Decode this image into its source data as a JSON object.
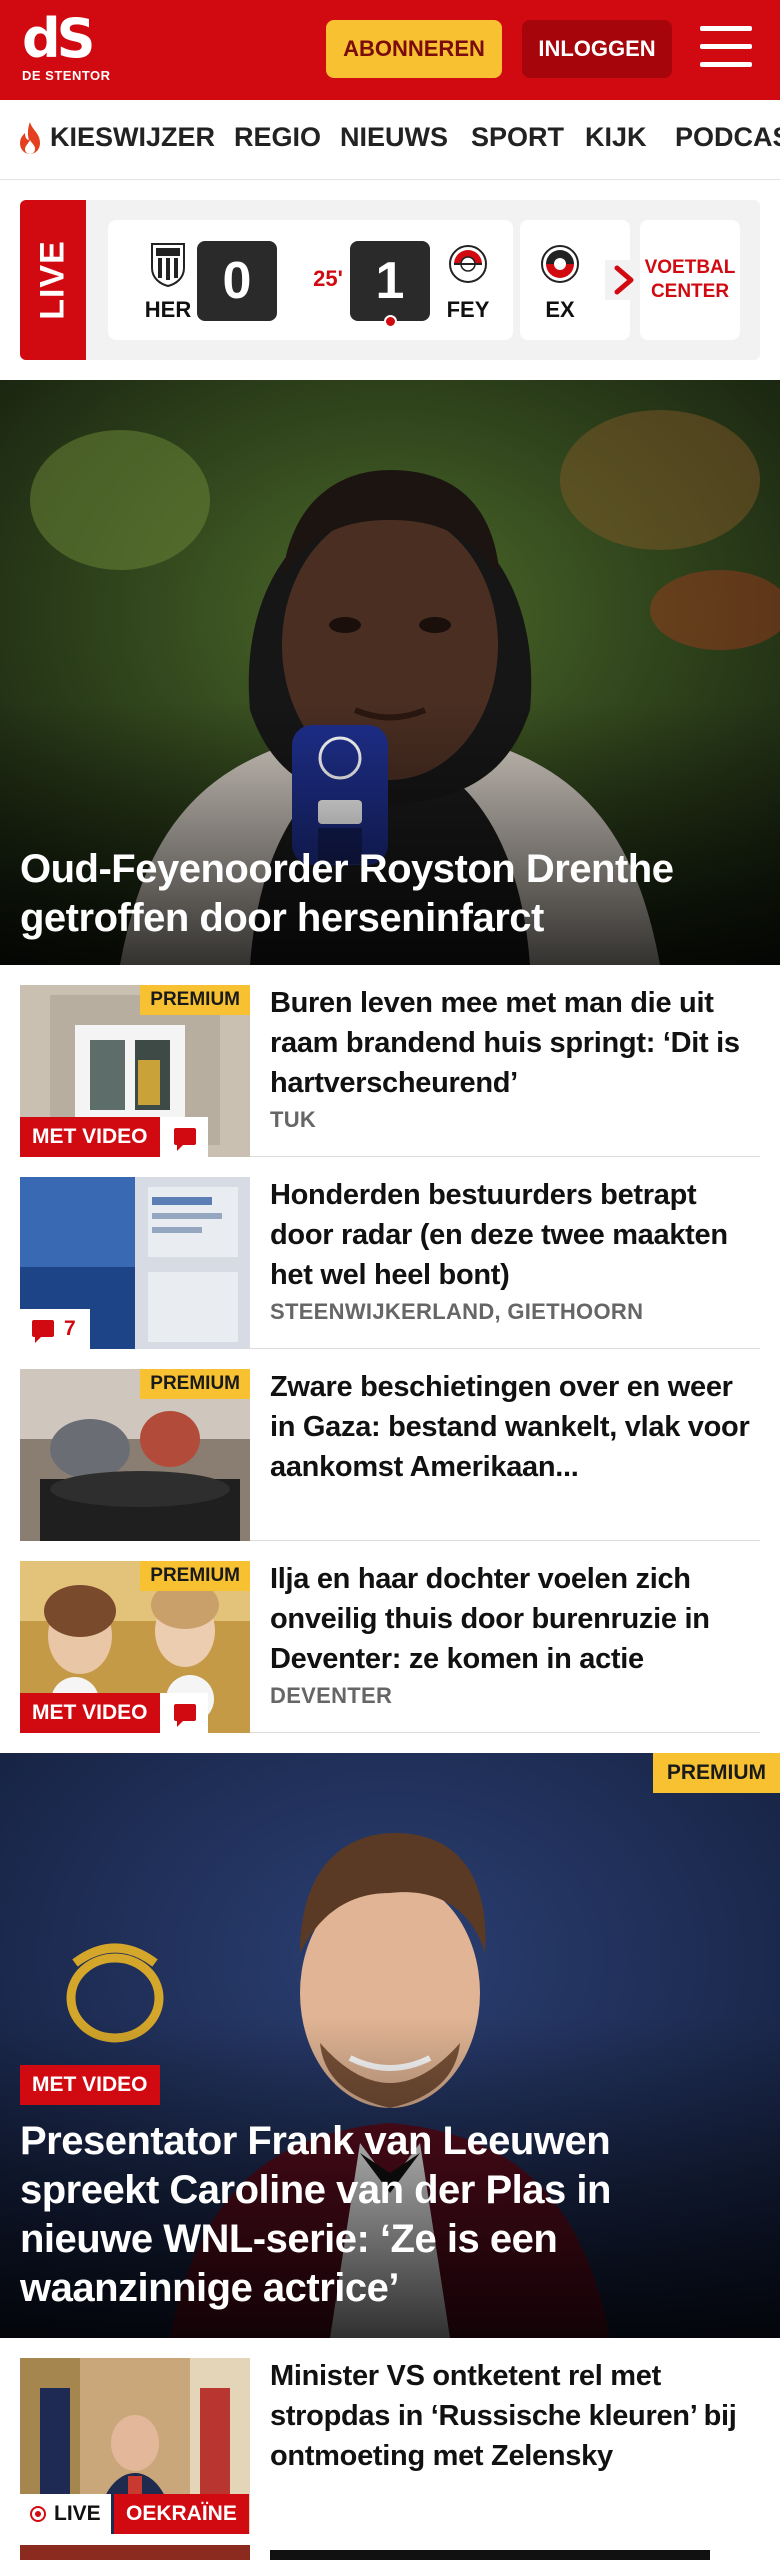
{
  "header": {
    "logo_mark": "dS",
    "logo_sub": "DE STENTOR",
    "subscribe_label": "ABONNEREN",
    "login_label": "INLOGGEN",
    "brand_color": "#d10a11",
    "accent_color": "#f7c132"
  },
  "nav": {
    "items": [
      "KIESWIJZER",
      "REGIO",
      "NIEUWS",
      "SPORT",
      "KIJK",
      "PODCAS"
    ]
  },
  "live": {
    "label": "LIVE",
    "match": {
      "home_code": "HER",
      "away_code": "FEY",
      "home_score": "0",
      "away_score": "1",
      "minute": "25'"
    },
    "next_match_code": "EX",
    "voetbal_center_label": "VOETBAL CENTER"
  },
  "hero": {
    "title": "Oud-Feyenoorder Royston Drenthe getroffen door herseninfarct"
  },
  "articles": [
    {
      "title": "Buren leven mee met man die uit raam brandend huis springt: ‘Dit is hartverscheurend’",
      "meta": "TUK",
      "premium": "PREMIUM",
      "video": "MET VIDEO"
    },
    {
      "title": "Honderden bestuurders betrapt door radar (en deze twee maakten het wel heel bont)",
      "meta": "STEENWIJKERLAND, GIETHOORN",
      "comments": "7"
    },
    {
      "title": "Zware beschietingen over en weer in Gaza: bestand wankelt, vlak voor aankomst Amerikaan...",
      "premium": "PREMIUM"
    },
    {
      "title": "Ilja en haar dochter voelen zich onveilig thuis door burenruzie in Deventer: ze komen in actie",
      "meta": "DEVENTER",
      "premium": "PREMIUM",
      "video": "MET VIDEO"
    }
  ],
  "feature": {
    "premium": "PREMIUM",
    "video": "MET VIDEO",
    "title": "Presentator Frank van Leeuwen spreekt Caroline van der Plas in nieuwe WNL-serie: ‘Ze is een waanzinnige actrice’"
  },
  "article_last": {
    "title": "Minister VS ontketent rel met stropdas in ‘Russische kleuren’ bij ontmoeting met Zelensky",
    "live_label": "LIVE",
    "tag": "OEKRAÏNE"
  }
}
